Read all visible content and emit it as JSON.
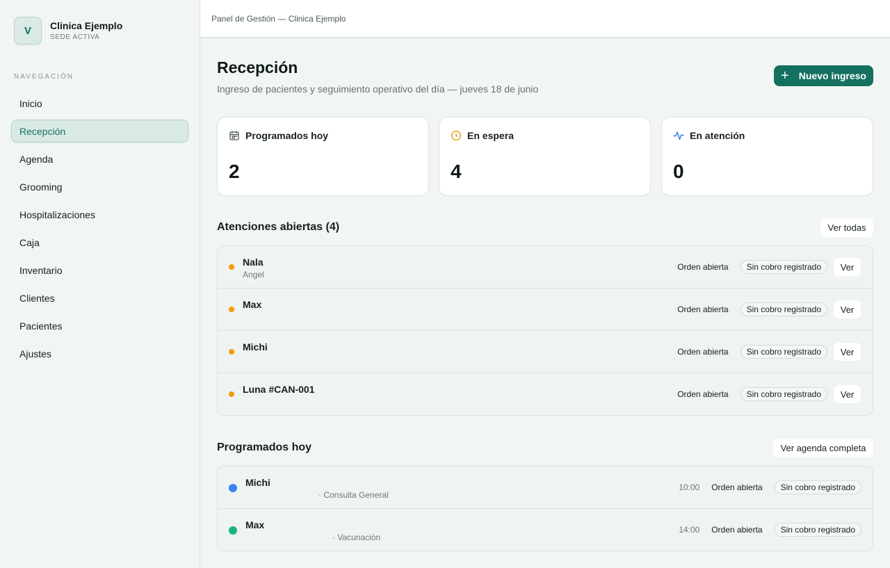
{
  "brand": {
    "initial": "V",
    "name": "Clinica Ejemplo",
    "subtitle": "SEDE ACTIVA"
  },
  "sidebar": {
    "section_title": "NAVEGACIÓN",
    "items": [
      {
        "label": "Inicio"
      },
      {
        "label": "Recepción",
        "active": true
      },
      {
        "label": "Agenda"
      },
      {
        "label": "Grooming"
      },
      {
        "label": "Hospitalizaciones"
      },
      {
        "label": "Caja"
      },
      {
        "label": "Inventario"
      },
      {
        "label": "Clientes"
      },
      {
        "label": "Pacientes"
      },
      {
        "label": "Ajustes"
      }
    ]
  },
  "topbar": {
    "breadcrumb": "Panel de Gestión — Clinica Ejemplo"
  },
  "page": {
    "title": "Recepción",
    "subtitle": "Ingreso de pacientes y seguimiento operativo del día — jueves 18 de junio",
    "new_button": "Nuevo ingreso"
  },
  "stats": [
    {
      "label": "Programados hoy",
      "value": "2",
      "icon": "calendar-icon",
      "color": "#4d5a57"
    },
    {
      "label": "En espera",
      "value": "4",
      "icon": "clock-icon",
      "color": "#e0a01a"
    },
    {
      "label": "En atención",
      "value": "0",
      "icon": "activity-icon",
      "color": "#2f7de1"
    }
  ],
  "open_care": {
    "title": "Atenciones abiertas (4)",
    "view_all": "Ver todas",
    "rows": [
      {
        "name": "Nala",
        "owner": "Angel",
        "status": "Orden abierta",
        "billing": "Sin cobro registrado",
        "action": "Ver"
      },
      {
        "name": "Max",
        "owner": "",
        "status": "Orden abierta",
        "billing": "Sin cobro registrado",
        "action": "Ver"
      },
      {
        "name": "Michi",
        "owner": "",
        "status": "Orden abierta",
        "billing": "Sin cobro registrado",
        "action": "Ver"
      },
      {
        "name": "Luna #CAN-001",
        "owner": "",
        "status": "Orden abierta",
        "billing": "Sin cobro registrado",
        "action": "Ver"
      }
    ],
    "dot_color": "#f29b0c"
  },
  "scheduled": {
    "title": "Programados hoy",
    "view_all": "Ver agenda completa",
    "rows": [
      {
        "name": "Michi",
        "service": "· Consulta General",
        "time": "10:00",
        "status": "Orden abierta",
        "billing": "Sin cobro registrado",
        "dot_color": "#3b82f0"
      },
      {
        "name": "Max",
        "service": "· Vacunación",
        "time": "14:00",
        "status": "Orden abierta",
        "billing": "Sin cobro registrado",
        "dot_color": "#19b486"
      }
    ]
  }
}
